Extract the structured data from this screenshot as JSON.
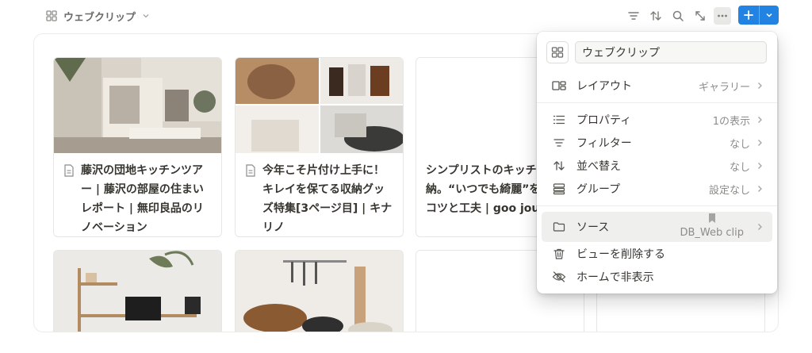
{
  "view": {
    "name": "ウェブクリップ",
    "icon": "gallery-icon"
  },
  "toolbar": {
    "icons": [
      "filter-icon",
      "sort-icon",
      "search-icon",
      "resize-icon",
      "more-icon"
    ],
    "new_icon": "plus-icon"
  },
  "cards": [
    {
      "title": "藤沢の団地キッチンツアー | 藤沢の部屋の住まいレポート | 無印良品のリノベーション"
    },
    {
      "title": "今年こそ片付け上手に！キレイを保てる収納グッズ特集[3ページ目] | キナリノ"
    },
    {
      "title": "シンプリストのキッチ納。“いつでも綺麗”を る、コツと工夫 | goo journal"
    },
    {
      "title": ""
    },
    {
      "title": ""
    },
    {
      "title": ""
    }
  ],
  "menu": {
    "name_value": "ウェブクリップ",
    "items": [
      {
        "label": "レイアウト",
        "value": "ギャラリー",
        "icon": "layout-icon"
      },
      {
        "label": "プロパティ",
        "value": "1の表示",
        "icon": "list-icon"
      },
      {
        "label": "フィルター",
        "value": "なし",
        "icon": "filter-icon"
      },
      {
        "label": "並べ替え",
        "value": "なし",
        "icon": "sort-icon"
      },
      {
        "label": "グループ",
        "value": "設定なし",
        "icon": "group-icon"
      },
      {
        "label": "ソース",
        "value": "DB_Web clip",
        "icon": "folder-icon",
        "value_icon": "bookmark-icon"
      },
      {
        "label": "ビューを削除する",
        "value": "",
        "icon": "trash-icon"
      },
      {
        "label": "ホームで非表示",
        "value": "",
        "icon": "eye-off-icon"
      }
    ]
  },
  "colors": {
    "accent": "#2383e2",
    "text": "#37352f",
    "muted": "#8d8c88"
  }
}
